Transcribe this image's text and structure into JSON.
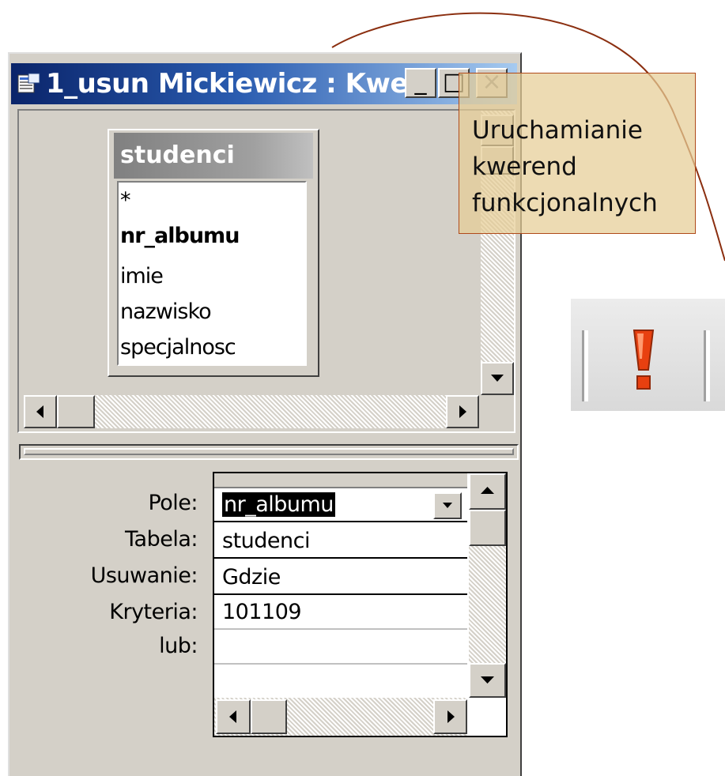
{
  "window": {
    "title": "1_usun Mickiewicz : Kwer...",
    "minimize_glyph": "_",
    "maximize_glyph": "□",
    "close_glyph": "×"
  },
  "table": {
    "name": "studenci",
    "fields": [
      "*",
      "nr_albumu",
      "imie",
      "nazwisko",
      "specjalnosc"
    ]
  },
  "grid": {
    "labels": [
      "Pole:",
      "Tabela:",
      "Usuwanie:",
      "Kryteria:",
      "lub:"
    ],
    "values": [
      "nr_albumu",
      "studenci",
      "Gdzie",
      "101109",
      ""
    ]
  },
  "callout": {
    "lines": [
      "Uruchamianie",
      "kwerend",
      "funkcjonalnych"
    ]
  },
  "icons": {
    "run": "exclamation-icon",
    "window": "query-window-icon"
  },
  "colors": {
    "titlebar_start": "#0a246a",
    "titlebar_end": "#a6caf0",
    "callout_fill": "#e6cd96",
    "callout_border": "#b04a1a",
    "run_icon": "#e84010"
  }
}
